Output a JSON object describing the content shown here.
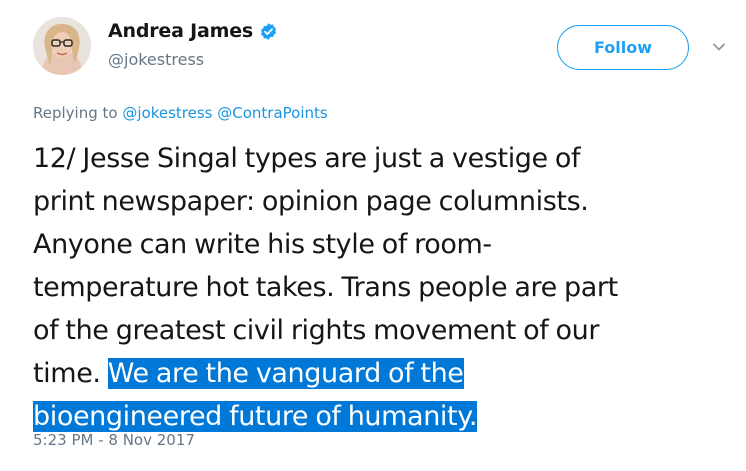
{
  "author": {
    "display_name": "Andrea James",
    "handle": "@jokestress",
    "verified": true,
    "avatar_icon": "profile-photo"
  },
  "actions": {
    "follow_label": "Follow",
    "menu_icon": "chevron-down-icon"
  },
  "reply": {
    "prefix": "Replying to",
    "mentions": [
      "@jokestress",
      "@ContraPoints"
    ]
  },
  "tweet": {
    "lines": [
      "12/ Jesse Singal types are just a vestige of",
      "print newspaper: opinion page columnists.",
      "Anyone can write his style of room-",
      "temperature hot takes. Trans people are part",
      "of the greatest civil rights movement of our"
    ],
    "line6_plain": "time. ",
    "line6_selected": "We are the vanguard of the",
    "line7_selected": "bioengineered future of humanity."
  },
  "timestamp": "5:23 PM - 8 Nov 2017",
  "colors": {
    "accent": "#1da1f2",
    "mention": "#1b95e0",
    "muted": "#657786",
    "selection": "#0078d7"
  }
}
